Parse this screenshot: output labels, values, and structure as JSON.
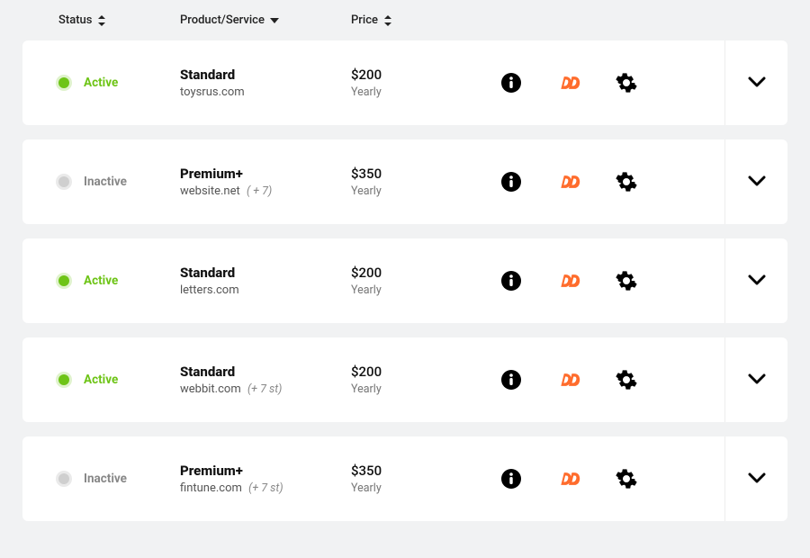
{
  "columns": {
    "status": "Status",
    "product": "Product/Service",
    "price": "Price"
  },
  "status_labels": {
    "active": "Active",
    "inactive": "Inactive"
  },
  "rows": [
    {
      "status": "active",
      "product_name": "Standard",
      "product_domain": "toysrus.com",
      "product_extra": "",
      "price": "$200",
      "price_period": "Yearly"
    },
    {
      "status": "inactive",
      "product_name": "Premium+",
      "product_domain": "website.net",
      "product_extra": "( + 7)",
      "price": "$350",
      "price_period": "Yearly"
    },
    {
      "status": "active",
      "product_name": "Standard",
      "product_domain": "letters.com",
      "product_extra": "",
      "price": "$200",
      "price_period": "Yearly"
    },
    {
      "status": "active",
      "product_name": "Standard",
      "product_domain": "webbit.com",
      "product_extra": "(+ 7 st)",
      "price": "$200",
      "price_period": "Yearly"
    },
    {
      "status": "inactive",
      "product_name": "Premium+",
      "product_domain": "fintune.com",
      "product_extra": "(+ 7 st)",
      "price": "$350",
      "price_period": "Yearly"
    }
  ],
  "colors": {
    "active": "#6ec417",
    "inactive": "#cfcfcf",
    "cpanel": "#ff6c2c",
    "icon": "#000000"
  }
}
